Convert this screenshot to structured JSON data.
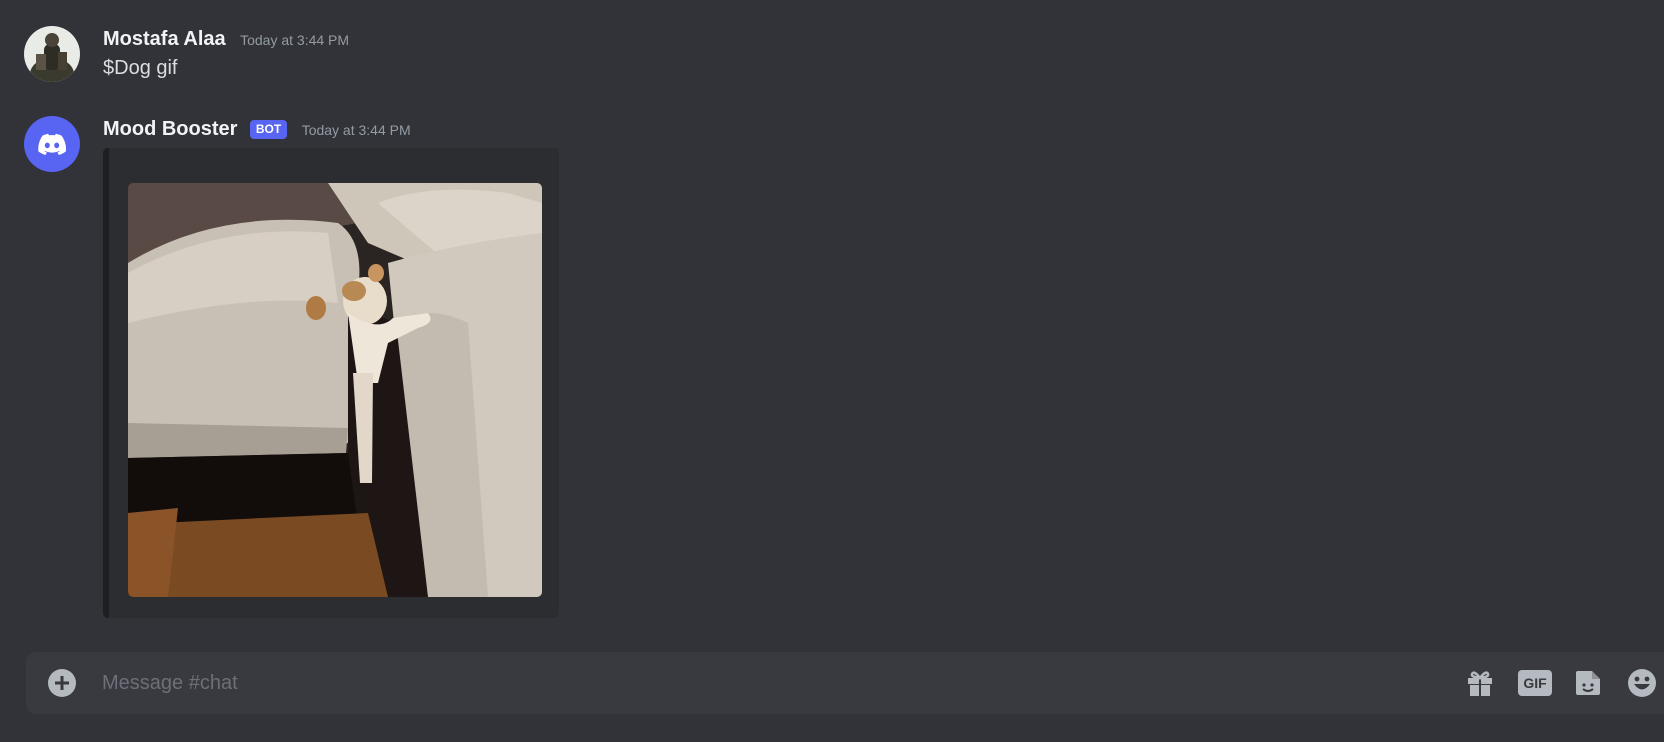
{
  "messages": [
    {
      "author": "Mostafa Alaa",
      "timestamp": "Today at 3:44 PM",
      "content": "$Dog gif",
      "avatar_icon": "user-avatar"
    },
    {
      "author": "Mood Booster",
      "badge": "BOT",
      "timestamp": "Today at 3:44 PM",
      "avatar_icon": "discord-logo-icon",
      "embed": {
        "image": "dog-on-couch-gif"
      }
    }
  ],
  "composer": {
    "placeholder": "Message #chat",
    "gif_label": "GIF"
  },
  "colors": {
    "background": "#313338",
    "composer": "#383a40",
    "embed": "#2b2d31",
    "bot_badge": "#5865f2",
    "avatar_blurple": "#5865f2"
  },
  "icons": [
    "add-attachment-icon",
    "gift-icon",
    "gif-icon",
    "sticker-icon",
    "emoji-icon"
  ]
}
